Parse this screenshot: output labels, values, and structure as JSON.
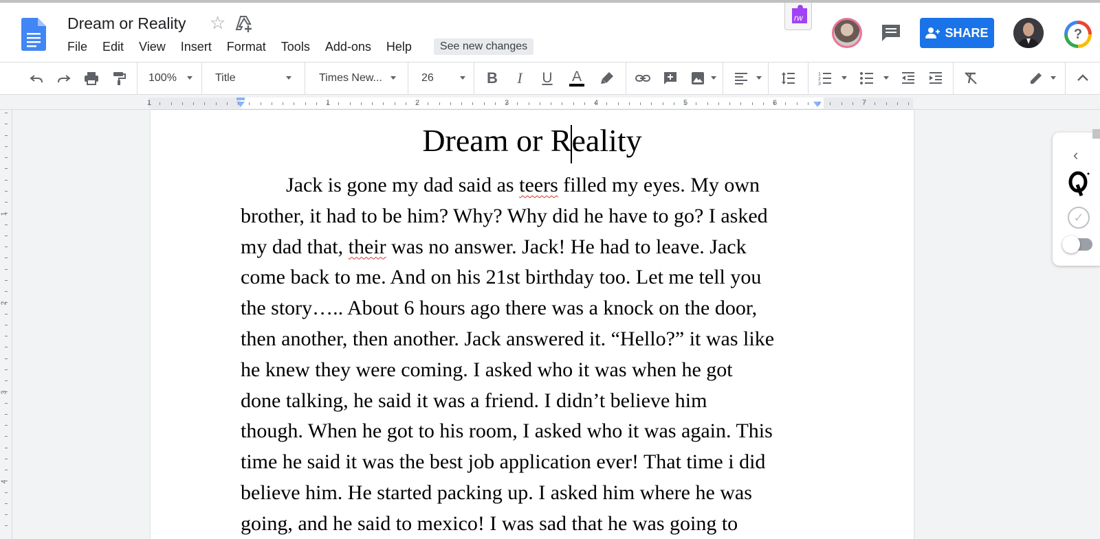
{
  "app": {
    "doc_title": "Dream or Reality",
    "menu": [
      "File",
      "Edit",
      "View",
      "Insert",
      "Format",
      "Tools",
      "Add-ons",
      "Help"
    ],
    "see_new_changes": "See new changes",
    "share_label": "SHARE",
    "addon_label": "rw",
    "help_glyph": "?"
  },
  "toolbar": {
    "zoom": "100%",
    "style": "Title",
    "font": "Times New...",
    "font_size": "26",
    "bold": "B",
    "italic": "I",
    "underline": "U",
    "text_color_glyph": "A"
  },
  "ruler": {
    "numbers": [
      "1",
      "1",
      "2",
      "3",
      "4",
      "5",
      "6",
      "7"
    ],
    "vertical_numbers": [
      "1",
      "2",
      "3",
      "4"
    ]
  },
  "document": {
    "heading": "Dream or Reality",
    "lines": [
      [
        "Jack is gone my dad said as ",
        {
          "t": "teers",
          "err": true
        },
        " filled my eyes. My own"
      ],
      [
        "brother, it had to be him? Why? Why did he have to go? I asked"
      ],
      [
        "my dad that, ",
        {
          "t": "their",
          "err": true
        },
        " was no answer. Jack! He had to leave. Jack"
      ],
      [
        "come back to me. And on his 21st birthday too. Let me tell you"
      ],
      [
        "the story….. About 6 hours ago there was a knock on the door,"
      ],
      [
        "then another, then another. Jack answered it. “Hello?” it was like"
      ],
      [
        "he knew they were coming. I asked who it was when he got"
      ],
      [
        "done talking, he said it was a friend. I  didn’t believe him"
      ],
      [
        "though. When he got to his room, I asked who it was again. This"
      ],
      [
        "time he said it was the best job application ever! That time i did"
      ],
      [
        "believe him. He started packing up. I asked him where he was"
      ],
      [
        "going, and he said to mexico! I was sad that he was going to"
      ]
    ]
  },
  "colors": {
    "share_blue": "#1a73e8",
    "docs_blue": "#4285f4",
    "misspell_red": "#d93025"
  },
  "icons": [
    "docs-logo-icon",
    "star-icon",
    "drive-add-icon",
    "addon-puzzle-icon",
    "comment-icon",
    "person-add-icon",
    "help-icon",
    "undo-icon",
    "redo-icon",
    "print-icon",
    "paint-format-icon",
    "highlight-icon",
    "link-icon",
    "insert-comment-icon",
    "image-icon",
    "align-icon",
    "line-spacing-icon",
    "numbered-list-icon",
    "bulleted-list-icon",
    "decrease-indent-icon",
    "increase-indent-icon",
    "clear-format-icon",
    "edit-mode-icon",
    "collapse-icon"
  ]
}
